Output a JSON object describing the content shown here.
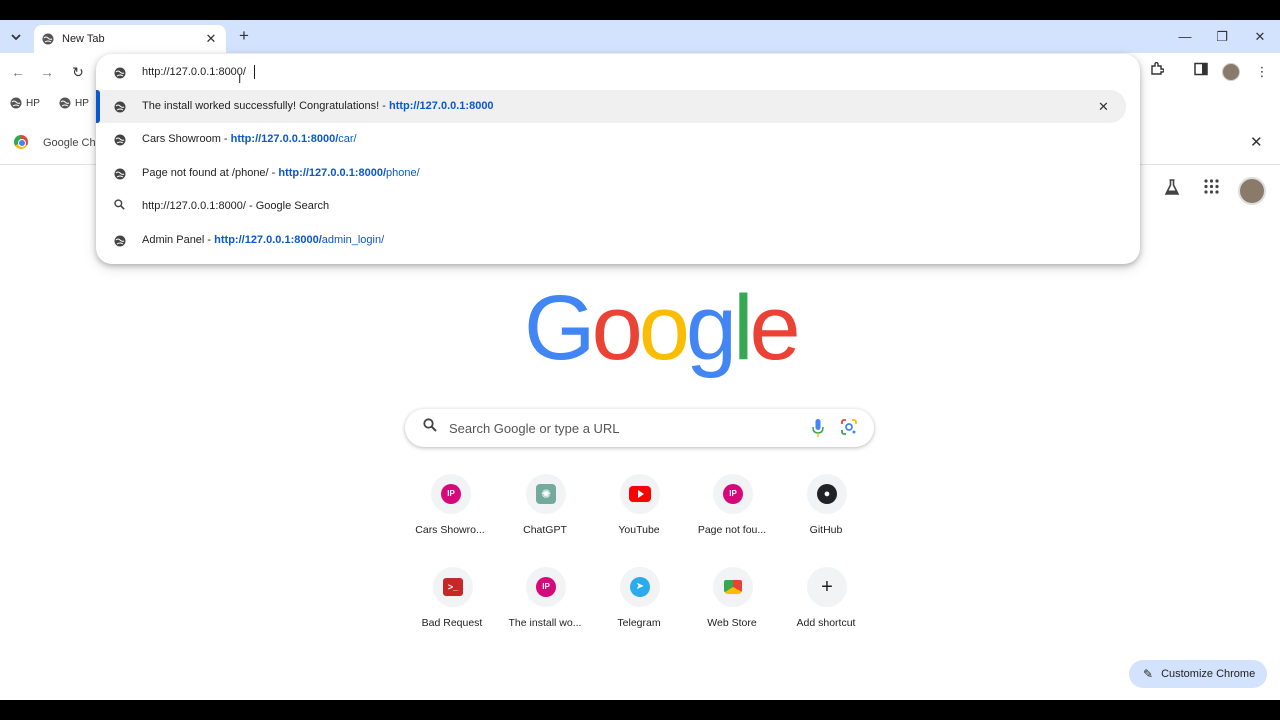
{
  "tabs": [
    {
      "title": "New Tab"
    }
  ],
  "window": {
    "minimize_glyph": "—",
    "restore_glyph": "❐",
    "close_glyph": "✕"
  },
  "bookmarks": [
    {
      "label": "HP"
    },
    {
      "label": "HP"
    }
  ],
  "infobar": {
    "text": "Google Ch"
  },
  "omnibox": {
    "value": "http://127.0.0.1:8000/",
    "suggestions": [
      {
        "title": "The install worked successfully! Congratulations! - ",
        "url_bold": "http://127.0.0.1:8000",
        "url_rest": "",
        "icon": "globe-icon",
        "selected": true
      },
      {
        "title": "Cars Showroom - ",
        "url_bold": "http://127.0.0.1:8000/",
        "url_rest": "car/",
        "icon": "globe-icon"
      },
      {
        "title": "Page not found at /phone/ - ",
        "url_bold": "http://127.0.0.1:8000/",
        "url_rest": "phone/",
        "icon": "globe-icon"
      },
      {
        "title": "http://127.0.0.1:8000/ - Google Search",
        "url_bold": "",
        "url_rest": "",
        "icon": "search-icon"
      },
      {
        "title": "Admin Panel - ",
        "url_bold": "http://127.0.0.1:8000/",
        "url_rest": "admin_login/",
        "icon": "globe-icon"
      }
    ]
  },
  "ntp": {
    "logo": {
      "letters": [
        "G",
        "o",
        "o",
        "g",
        "l",
        "e"
      ],
      "colors": [
        "#4285f4",
        "#ea4335",
        "#fbbc04",
        "#4285f4",
        "#34a853",
        "#ea4335"
      ]
    },
    "search": {
      "placeholder": "Search Google or type a URL"
    },
    "shortcuts": [
      {
        "label": "Cars Showro...",
        "favicon": "ip-icon"
      },
      {
        "label": "ChatGPT",
        "favicon": "chatgpt-icon"
      },
      {
        "label": "YouTube",
        "favicon": "youtube-icon"
      },
      {
        "label": "Page not fou...",
        "favicon": "ip-icon"
      },
      {
        "label": "GitHub",
        "favicon": "github-icon"
      },
      {
        "label": "Bad Request",
        "favicon": "terminal-icon"
      },
      {
        "label": "The install wo...",
        "favicon": "ip-icon"
      },
      {
        "label": "Telegram",
        "favicon": "telegram-icon"
      },
      {
        "label": "Web Store",
        "favicon": "webstore-icon"
      },
      {
        "label": "Add shortcut",
        "favicon": "plus-icon"
      }
    ],
    "customize_label": "Customize Chrome"
  },
  "colors": {
    "accent": "#0b57d0",
    "tabstrip": "#d3e3fd",
    "customize_bg": "#d3e3fd"
  }
}
